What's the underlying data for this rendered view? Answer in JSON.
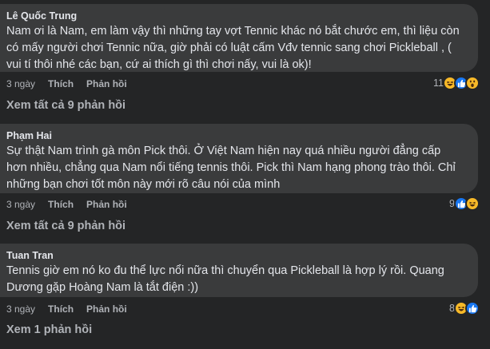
{
  "comments": [
    {
      "author": "Lê Quốc Trung",
      "lines": [
        "Nam ơi là Nam, em làm vậy thì những tay vợt Tennic khác nó bắt chước em, thì liệu còn",
        "có mấy người chơi Tennic nữa, giờ phải có luật cấm Vđv tennic sang chơi Pickleball , (",
        "vui tí thôi nhé các bạn, cứ ai thích gì thì chơi nấy, vui là ok)!"
      ],
      "time": "3 ngày",
      "like_label": "Thích",
      "reply_label": "Phản hồi",
      "reaction_count": "11",
      "reactions": [
        "haha-icon",
        "like-icon",
        "wow-icon"
      ],
      "view_replies": "Xem tất cả 9 phản hồi"
    },
    {
      "author": "Phạm Hai",
      "lines": [
        "Sự thật Nam trình gà môn Pick thôi. Ở Việt Nam hiện nay quá nhiều người đẳng cấp",
        "hơn nhiều, chẳng qua Nam nổi tiếng tennis thôi. Pick thì Nam hạng phong trào thôi. Chỉ",
        "những bạn chơi tốt môn này mới rõ câu nói của mình"
      ],
      "time": "3 ngày",
      "like_label": "Thích",
      "reply_label": "Phản hồi",
      "reaction_count": "9",
      "reactions": [
        "like-icon",
        "haha-icon"
      ],
      "view_replies": "Xem tất cả 9 phản hồi"
    },
    {
      "author": "Tuan Tran",
      "lines": [
        "Tennis giờ em nó ko đu thể lực nổi nữa thì chuyển qua Pickleball là hợp lý rồi. Quang",
        "Dương gặp Hoàng Nam là tắt điện :))"
      ],
      "time": "3 ngày",
      "like_label": "Thích",
      "reply_label": "Phản hồi",
      "reaction_count": "8",
      "reactions": [
        "haha-icon",
        "like-icon"
      ],
      "view_replies": "Xem 1 phản hồi"
    }
  ],
  "colors": {
    "background": "#242526",
    "bubble": "#3a3b3c",
    "text": "#e4e6eb",
    "muted": "#b0b3b8",
    "like_blue": "#1877f2",
    "emoji_yellow": "#f7b928"
  }
}
